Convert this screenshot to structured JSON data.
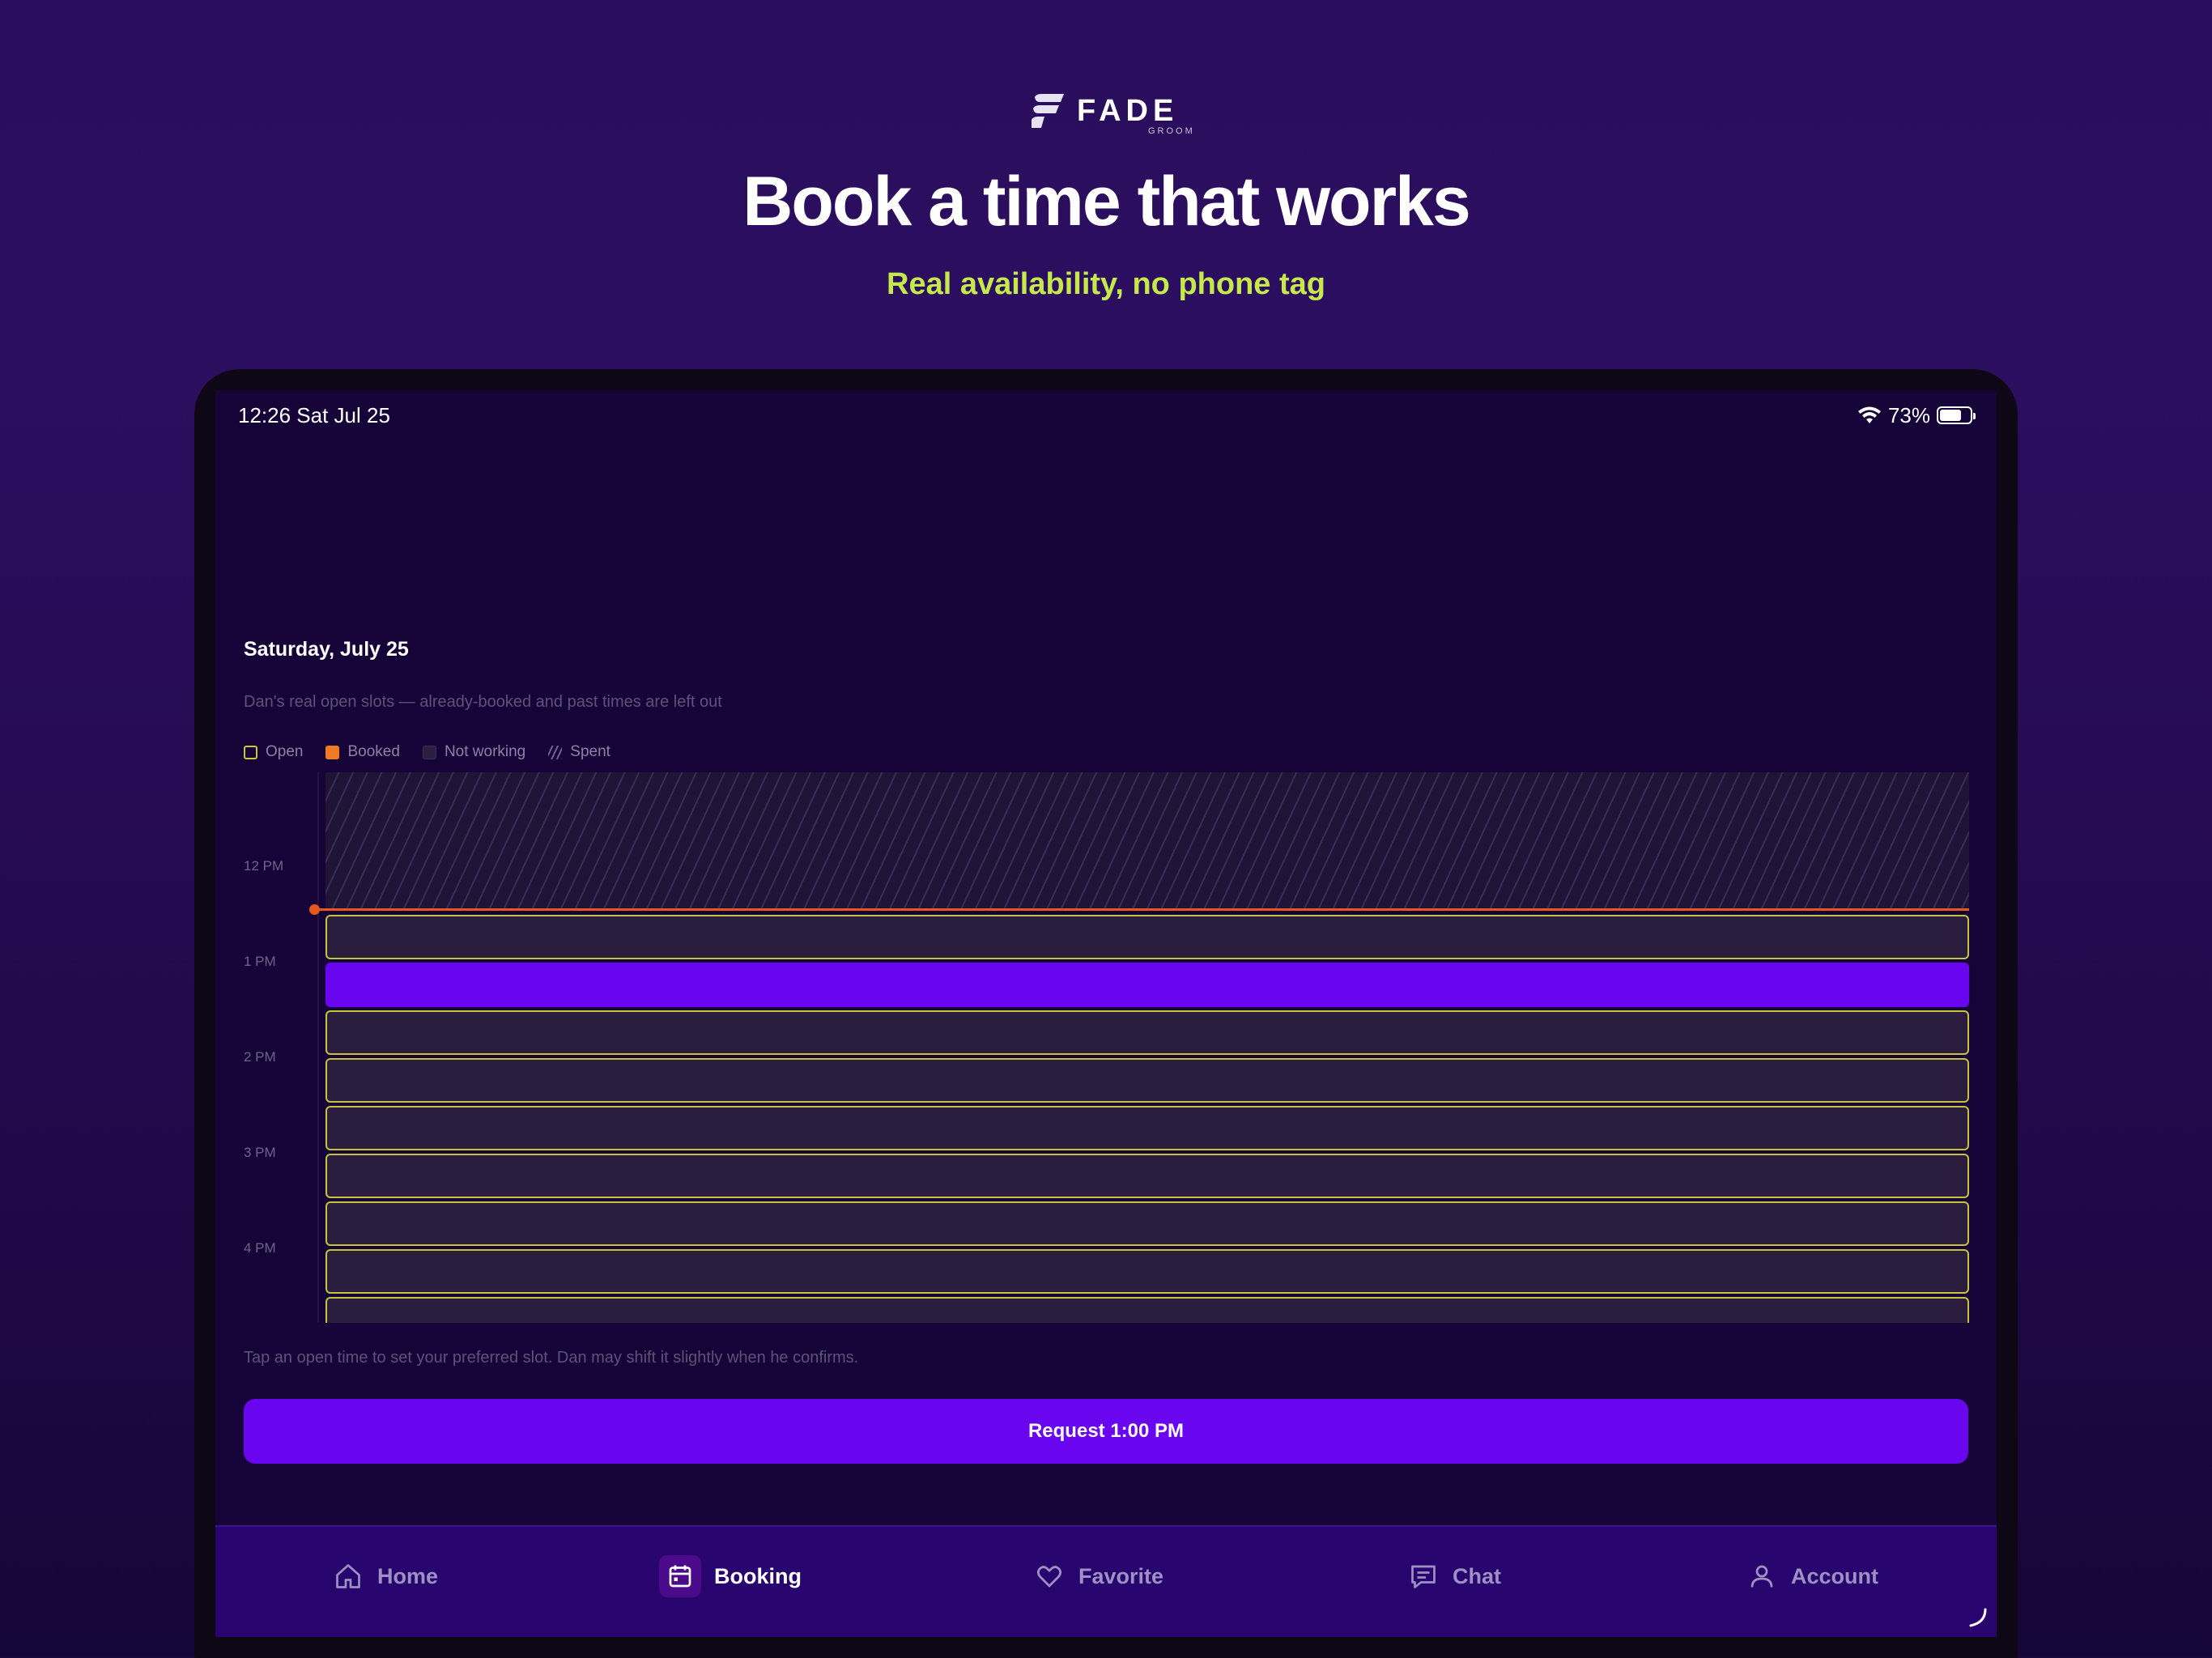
{
  "brand": {
    "name": "FADE",
    "tagline": "GROOM"
  },
  "hero": {
    "headline": "Book a time that works",
    "subheadline": "Real availability, no phone tag"
  },
  "status_bar": {
    "time_date": "12:26  Sat Jul 25",
    "battery_text": "73%",
    "battery_level": 0.73
  },
  "schedule": {
    "date_title": "Saturday, July 25",
    "description": "Dan's real open slots — already-booked and past times are left out",
    "legend": {
      "open": "Open",
      "booked": "Booked",
      "not_working": "Not working",
      "spent": "Spent"
    },
    "hours": [
      "12 PM",
      "1 PM",
      "2 PM",
      "3 PM",
      "4 PM"
    ],
    "slots": [
      {
        "state": "open"
      },
      {
        "state": "selected"
      },
      {
        "state": "open"
      },
      {
        "state": "open"
      },
      {
        "state": "open"
      },
      {
        "state": "open"
      },
      {
        "state": "open"
      },
      {
        "state": "open"
      },
      {
        "state": "open"
      }
    ],
    "hint": "Tap an open time to set your preferred slot. Dan may shift it slightly when he confirms.",
    "request_label": "Request 1:00 PM"
  },
  "tabs": [
    {
      "label": "Home",
      "icon": "home-icon",
      "active": false
    },
    {
      "label": "Booking",
      "icon": "calendar-icon",
      "active": true
    },
    {
      "label": "Favorite",
      "icon": "heart-icon",
      "active": false
    },
    {
      "label": "Chat",
      "icon": "chat-icon",
      "active": false
    },
    {
      "label": "Account",
      "icon": "user-icon",
      "active": false
    }
  ],
  "colors": {
    "accent": "#6a05f0",
    "highlight": "#c5e84a",
    "open_outline": "#c4c33e",
    "booked": "#f07a26",
    "now_line": "#e8581d"
  }
}
